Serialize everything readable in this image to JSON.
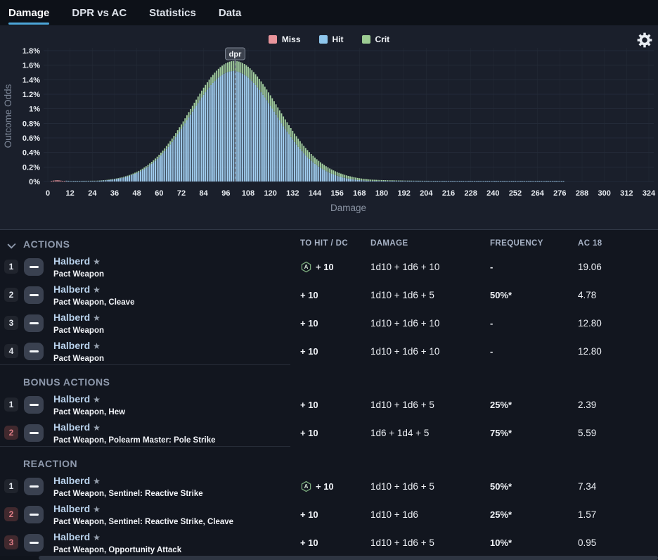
{
  "tabs": [
    {
      "label": "Damage",
      "active": true
    },
    {
      "label": "DPR vs AC",
      "active": false
    },
    {
      "label": "Statistics",
      "active": false
    },
    {
      "label": "Data",
      "active": false
    }
  ],
  "legend": [
    {
      "label": "Miss",
      "color": "#e8949b"
    },
    {
      "label": "Hit",
      "color": "#8ec6ec"
    },
    {
      "label": "Crit",
      "color": "#9ccb92"
    }
  ],
  "chart_data": {
    "type": "bar",
    "subtype": "stacked-probability-histogram",
    "title": "",
    "xlabel": "Damage",
    "ylabel": "Outcome Odds",
    "xlim": [
      0,
      324
    ],
    "ylim_percent": [
      0,
      1.8
    ],
    "x_ticks": [
      0,
      12,
      24,
      36,
      48,
      60,
      72,
      84,
      96,
      108,
      120,
      132,
      144,
      156,
      168,
      180,
      192,
      204,
      216,
      228,
      240,
      252,
      264,
      276,
      288,
      300,
      312,
      324
    ],
    "y_tick_labels": [
      "0%",
      "0.2%",
      "0.4%",
      "0.6%",
      "0.8%",
      "1%",
      "1.2%",
      "1.4%",
      "1.6%",
      "1.8%"
    ],
    "dpr_marker": {
      "label": "dpr",
      "x": 101
    },
    "series": [
      {
        "name": "Miss",
        "bar_color": "#e8949b",
        "gauss": {
          "mean": 5,
          "sigma": 2.5,
          "peak_percent": 0.018
        }
      },
      {
        "name": "Hit",
        "bar_color": "#a3d0f2",
        "gauss": {
          "mean": 100,
          "sigma": 23,
          "peak_percent": 1.52
        }
      },
      {
        "name": "Crit",
        "bar_color": "#a3cfa0",
        "gauss": {
          "mean": 112,
          "sigma": 30,
          "peak_percent": 0.15
        }
      }
    ],
    "sampled_x_every_12": [
      0,
      12,
      24,
      36,
      48,
      60,
      72,
      84,
      96,
      108,
      120,
      132,
      144,
      156,
      168,
      180,
      192,
      204
    ],
    "hit_percent_samples": [
      0,
      0.001,
      0.007,
      0.032,
      0.118,
      0.335,
      0.724,
      1.193,
      1.497,
      1.431,
      1.042,
      0.577,
      0.244,
      0.078,
      0.019,
      0.004,
      0.001,
      0
    ],
    "crit_percent_samples": [
      0,
      0,
      0.002,
      0.006,
      0.015,
      0.033,
      0.062,
      0.097,
      0.13,
      0.149,
      0.145,
      0.12,
      0.085,
      0.051,
      0.026,
      0.012,
      0.004,
      0.001
    ],
    "tail_extends_to_x": 278
  },
  "table": {
    "columns": [
      "TO HIT / DC",
      "DAMAGE",
      "FREQUENCY",
      "AC 18"
    ],
    "sections": [
      {
        "title": "ACTIONS",
        "chevron": true,
        "rows": [
          {
            "num": "1",
            "num_style": "dark",
            "name": "Halberd",
            "star": "★",
            "subtitle": "Pact Weapon",
            "advantage": true,
            "to_hit": "+ 10",
            "damage": "1d10 + 1d6 + 10",
            "frequency": "-",
            "ac_value": "19.06"
          },
          {
            "num": "2",
            "num_style": "dark",
            "name": "Halberd",
            "star": "★",
            "subtitle": "Pact Weapon, Cleave",
            "advantage": false,
            "to_hit": "+ 10",
            "damage": "1d10 + 1d6 + 5",
            "frequency": "50%*",
            "ac_value": "4.78"
          },
          {
            "num": "3",
            "num_style": "dark",
            "name": "Halberd",
            "star": "★",
            "subtitle": "Pact Weapon",
            "advantage": false,
            "to_hit": "+ 10",
            "damage": "1d10 + 1d6 + 10",
            "frequency": "-",
            "ac_value": "12.80"
          },
          {
            "num": "4",
            "num_style": "dark",
            "name": "Halberd",
            "star": "★",
            "subtitle": "Pact Weapon",
            "advantage": false,
            "to_hit": "+ 10",
            "damage": "1d10 + 1d6 + 10",
            "frequency": "-",
            "ac_value": "12.80"
          }
        ]
      },
      {
        "title": "BONUS ACTIONS",
        "chevron": false,
        "rows": [
          {
            "num": "1",
            "num_style": "dark",
            "name": "Halberd",
            "star": "★",
            "subtitle": "Pact Weapon, Hew",
            "advantage": false,
            "to_hit": "+ 10",
            "damage": "1d10 + 1d6 + 5",
            "frequency": "25%*",
            "ac_value": "2.39"
          },
          {
            "num": "2",
            "num_style": "red",
            "name": "Halberd",
            "star": "★",
            "subtitle": "Pact Weapon, Polearm Master: Pole Strike",
            "advantage": false,
            "to_hit": "+ 10",
            "damage": "1d6 + 1d4 + 5",
            "frequency": "75%*",
            "ac_value": "5.59"
          }
        ]
      },
      {
        "title": "REACTION",
        "chevron": false,
        "rows": [
          {
            "num": "1",
            "num_style": "dark",
            "name": "Halberd",
            "star": "★",
            "subtitle": "Pact Weapon, Sentinel: Reactive Strike",
            "advantage": true,
            "to_hit": "+ 10",
            "damage": "1d10 + 1d6 + 5",
            "frequency": "50%*",
            "ac_value": "7.34"
          },
          {
            "num": "2",
            "num_style": "red",
            "name": "Halberd",
            "star": "★",
            "subtitle": "Pact Weapon, Sentinel: Reactive Strike, Cleave",
            "advantage": false,
            "to_hit": "+ 10",
            "damage": "1d10 + 1d6",
            "frequency": "25%*",
            "ac_value": "1.57"
          },
          {
            "num": "3",
            "num_style": "red",
            "name": "Halberd",
            "star": "★",
            "subtitle": "Pact Weapon, Opportunity Attack",
            "advantage": false,
            "to_hit": "+ 10",
            "damage": "1d10 + 1d6 + 5",
            "frequency": "10%*",
            "ac_value": "0.95"
          }
        ]
      }
    ]
  },
  "icons": {
    "settings": "gear-icon",
    "advantage": "advantage-hexagon-A-icon",
    "advantage_color": "#79a87b",
    "section_chevron": "chevron-down-icon"
  },
  "colors": {
    "accent_tab_underline": "#4da6d9",
    "chart_bg": "#1a1f2b",
    "table_bg": "#12161f",
    "dpr_line": "#8a93a3"
  }
}
